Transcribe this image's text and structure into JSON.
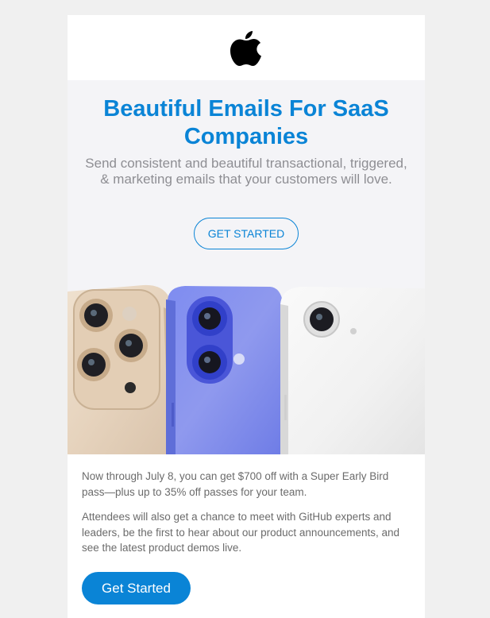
{
  "logo": {
    "icon": "apple-logo-icon"
  },
  "hero": {
    "title": "Beautiful Emails For SaaS Companies",
    "subtitle": "Send consistent and beautiful transactional, triggered, & marketing emails that your customers will love.",
    "cta_label": "GET STARTED"
  },
  "image": {
    "description_icon": "phones-image"
  },
  "body": {
    "paragraph_1": "Now through July 8, you can get $700 off with a Super Early Bird pass—plus up to 35% off passes for your team.",
    "paragraph_2": "Attendees will also get a chance to meet with GitHub experts and leaders, be the first to hear about our product announcements, and see the latest product demos live.",
    "cta_label": "Get Started"
  },
  "colors": {
    "accent": "#0a84d6",
    "hero_background": "#f4f4f7",
    "page_background": "#f0f0f0"
  }
}
